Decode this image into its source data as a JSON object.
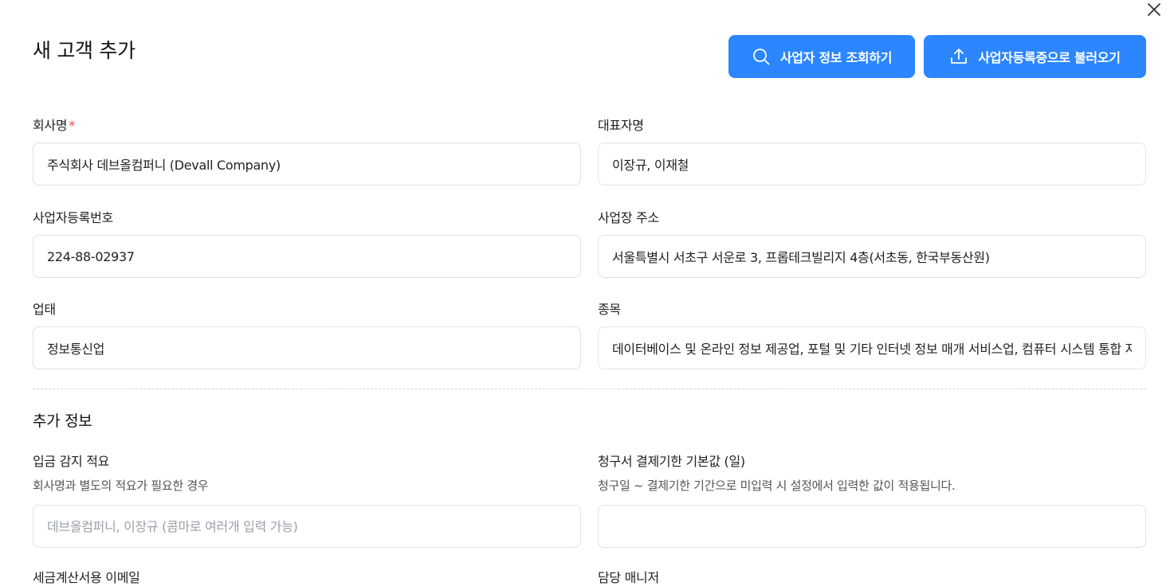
{
  "modal": {
    "title": "새 고객 추가",
    "close_icon": "close-icon"
  },
  "header_buttons": {
    "lookup_label": "사업자 정보 조회하기",
    "lookup_icon": "search-icon",
    "upload_label": "사업자등록증으로 불러오기",
    "upload_icon": "upload-icon",
    "color": "#2b86ff"
  },
  "fields": {
    "company_name": {
      "label": "회사명",
      "required_mark": "*",
      "value": "주식회사 데브올컴퍼니 (Devall Company)"
    },
    "representative": {
      "label": "대표자명",
      "value": "이장규, 이재철"
    },
    "business_number": {
      "label": "사업자등록번호",
      "value": "224-88-02937"
    },
    "business_address": {
      "label": "사업장 주소",
      "value": "서울특별시 서초구 서운로 3, 프롭테크빌리지 4층(서초동, 한국부동산원)"
    },
    "business_type": {
      "label": "업태",
      "value": "정보통신업"
    },
    "business_item": {
      "label": "종목",
      "value": "데이터베이스 및 온라인 정보 제공업, 포털 및 기타 인터넷 정보 매개 서비스업, 컴퓨터 시스템 통합 자문 및 구축 서비스업"
    }
  },
  "extra": {
    "section_title": "추가 정보",
    "deposit_memo": {
      "label": "입금 감지 적요",
      "description": "회사명과 별도의 적요가 필요한 경우",
      "placeholder": "데브올컴퍼니, 이장규 (콤마로 여러개 입력 가능)",
      "value": ""
    },
    "due_days": {
      "label": "청구서 결제기한 기본값 (일)",
      "description": "청구일 ~ 결제기한 기간으로 미입력 시 설정에서 입력한 값이 적용됩니다.",
      "value": ""
    },
    "tax_invoice_email": {
      "label": "세금계산서용 이메일"
    },
    "manager": {
      "label": "담당 매니저"
    }
  }
}
